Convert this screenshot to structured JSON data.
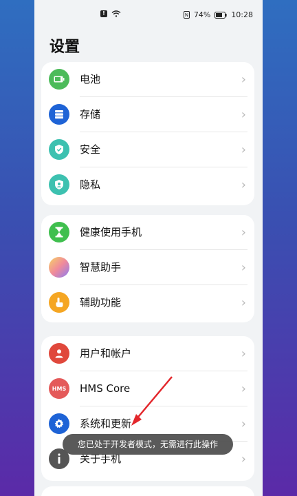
{
  "status_bar": {
    "battery_percent": "74%",
    "time": "10:28"
  },
  "page": {
    "title": "设置"
  },
  "groups": [
    {
      "items": [
        {
          "label": "电池",
          "icon": "battery-icon",
          "color": "#4cbb5a"
        },
        {
          "label": "存储",
          "icon": "storage-icon",
          "color": "#1e63d6"
        },
        {
          "label": "安全",
          "icon": "shield-check-icon",
          "color": "#3dc1b0"
        },
        {
          "label": "隐私",
          "icon": "privacy-icon",
          "color": "#3dc1b0"
        }
      ]
    },
    {
      "items": [
        {
          "label": "健康使用手机",
          "icon": "hourglass-icon",
          "color": "#3fbf4e"
        },
        {
          "label": "智慧助手",
          "icon": "assistant-icon",
          "color": "#f29a7e"
        },
        {
          "label": "辅助功能",
          "icon": "hand-icon",
          "color": "#f5a623"
        }
      ]
    },
    {
      "items": [
        {
          "label": "用户和帐户",
          "icon": "user-icon",
          "color": "#e0483c"
        },
        {
          "label": "HMS Core",
          "icon": "hms-icon",
          "color": "#e45a5a",
          "icon_text": "HMS"
        },
        {
          "label": "系统和更新",
          "icon": "gear-icon",
          "color": "#1e63d6"
        },
        {
          "label": "关于手机",
          "icon": "info-icon",
          "color": "#555555"
        }
      ]
    }
  ],
  "toast": {
    "text": "您已处于开发者模式，无需进行此操作"
  }
}
